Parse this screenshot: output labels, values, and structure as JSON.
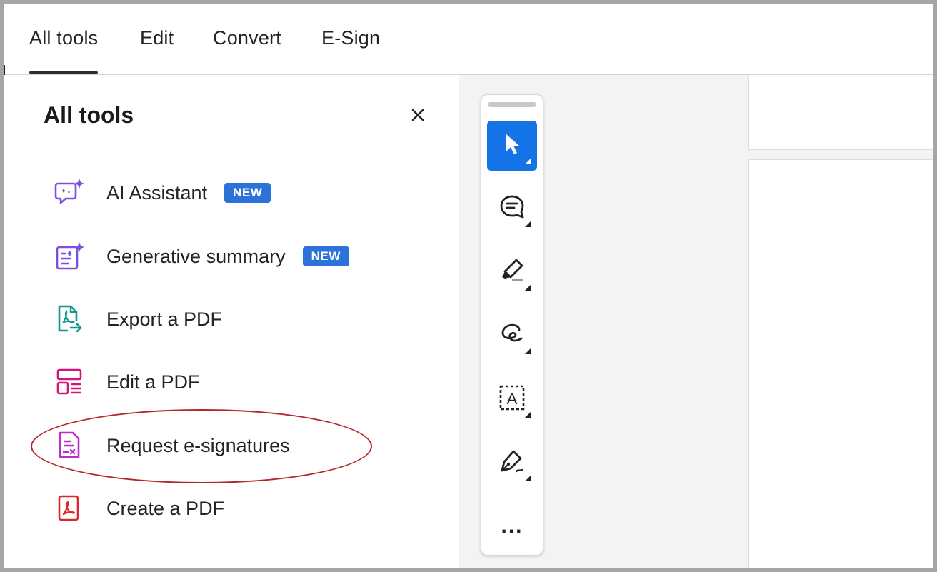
{
  "tabs": [
    {
      "label": "All tools",
      "active": true
    },
    {
      "label": "Edit"
    },
    {
      "label": "Convert"
    },
    {
      "label": "E-Sign"
    }
  ],
  "panel": {
    "title": "All tools",
    "close_icon": "close-icon",
    "items": [
      {
        "label": "AI Assistant",
        "badge": "NEW",
        "icon": "ai-assistant-icon",
        "color": "#7b4fe0"
      },
      {
        "label": "Generative summary",
        "badge": "NEW",
        "icon": "generative-summary-icon",
        "color": "#7b4fe0"
      },
      {
        "label": "Export a PDF",
        "icon": "export-pdf-icon",
        "color": "#17968a"
      },
      {
        "label": "Edit a PDF",
        "icon": "edit-pdf-icon",
        "color": "#d6157b"
      },
      {
        "label": "Request e-signatures",
        "icon": "request-esignatures-icon",
        "color": "#b92fc8",
        "highlighted": true
      },
      {
        "label": "Create a PDF",
        "icon": "create-pdf-icon",
        "color": "#e0262d"
      }
    ]
  },
  "toolbar": {
    "tools": [
      {
        "name": "select-tool",
        "icon": "cursor-icon",
        "active": true
      },
      {
        "name": "comment-tool",
        "icon": "comment-icon"
      },
      {
        "name": "highlight-tool",
        "icon": "highlighter-icon"
      },
      {
        "name": "draw-tool",
        "icon": "freehand-draw-icon"
      },
      {
        "name": "text-tool",
        "icon": "text-box-icon"
      },
      {
        "name": "sign-tool",
        "icon": "pen-sign-icon"
      },
      {
        "name": "more-tools",
        "icon": "more-icon",
        "label": "..."
      }
    ]
  },
  "colors": {
    "accent": "#1473e6",
    "badge": "#2c72d8",
    "highlight_ring": "#b5262a"
  }
}
